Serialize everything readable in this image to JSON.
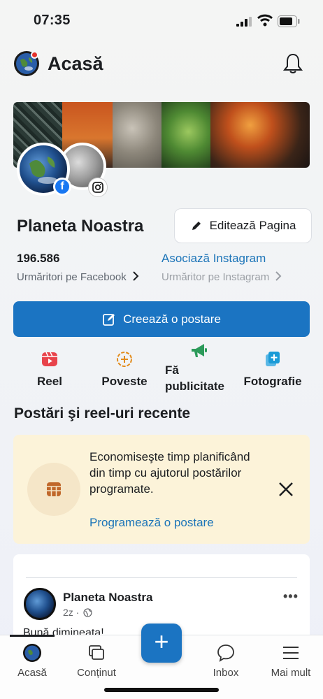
{
  "status": {
    "time": "07:35"
  },
  "header": {
    "title": "Acasă"
  },
  "profile": {
    "name": "Planeta Noastra",
    "edit_label": "Editează Pagina",
    "fb_count": "196.586",
    "fb_followers_label": "Urmăritori pe Facebook",
    "ig_link": "Asociază Instagram",
    "ig_followers_label": "Urmăritor pe Instagram"
  },
  "create_post_label": "Creează o postare",
  "actions": [
    {
      "label": "Reel",
      "icon": "reel-icon"
    },
    {
      "label": "Poveste",
      "icon": "story-icon"
    },
    {
      "label": "Fă publicitate",
      "icon": "megaphone-icon"
    },
    {
      "label": "Fotografie",
      "icon": "photo-icon"
    }
  ],
  "section_title": "Postări şi reel-uri recente",
  "promo": {
    "text": "Economiseşte timp planificând din timp cu ajutorul postărilor programate.",
    "link": "Programează o postare"
  },
  "post": {
    "author": "Planeta Noastra",
    "meta": "2z ·",
    "text": "Bună dimineața!"
  },
  "tabbar": {
    "home": "Acasă",
    "content": "Conținut",
    "inbox": "Inbox",
    "more": "Mai mult"
  },
  "colors": {
    "accent": "#1b74c2",
    "link": "#1b74b8",
    "promo_bg": "#fcf3d9"
  }
}
